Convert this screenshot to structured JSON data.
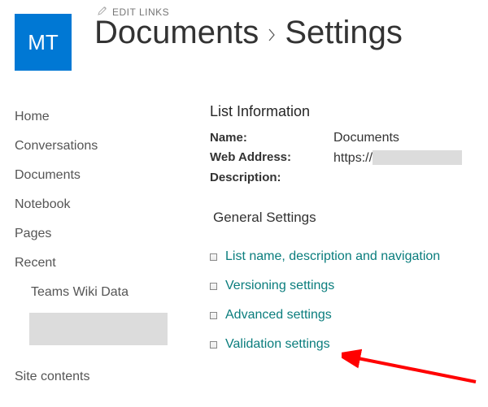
{
  "site": {
    "logo_text": "MT",
    "edit_links_label": "EDIT LINKS"
  },
  "breadcrumb": {
    "parent": "Documents",
    "current": "Settings"
  },
  "leftnav": {
    "items": [
      {
        "label": "Home"
      },
      {
        "label": "Conversations"
      },
      {
        "label": "Documents"
      },
      {
        "label": "Notebook"
      },
      {
        "label": "Pages"
      },
      {
        "label": "Recent"
      }
    ],
    "sub_items": [
      {
        "label": "Teams Wiki Data"
      }
    ],
    "footer_label": "Site contents"
  },
  "list_info": {
    "heading": "List Information",
    "name_label": "Name:",
    "name_value": "Documents",
    "webaddr_label": "Web Address:",
    "webaddr_prefix": "https://",
    "desc_label": "Description:"
  },
  "general_settings": {
    "heading": "General Settings",
    "links": [
      {
        "label": "List name, description and navigation"
      },
      {
        "label": "Versioning settings"
      },
      {
        "label": "Advanced settings"
      },
      {
        "label": "Validation settings"
      }
    ]
  },
  "annotation": {
    "color": "#ff0000"
  }
}
